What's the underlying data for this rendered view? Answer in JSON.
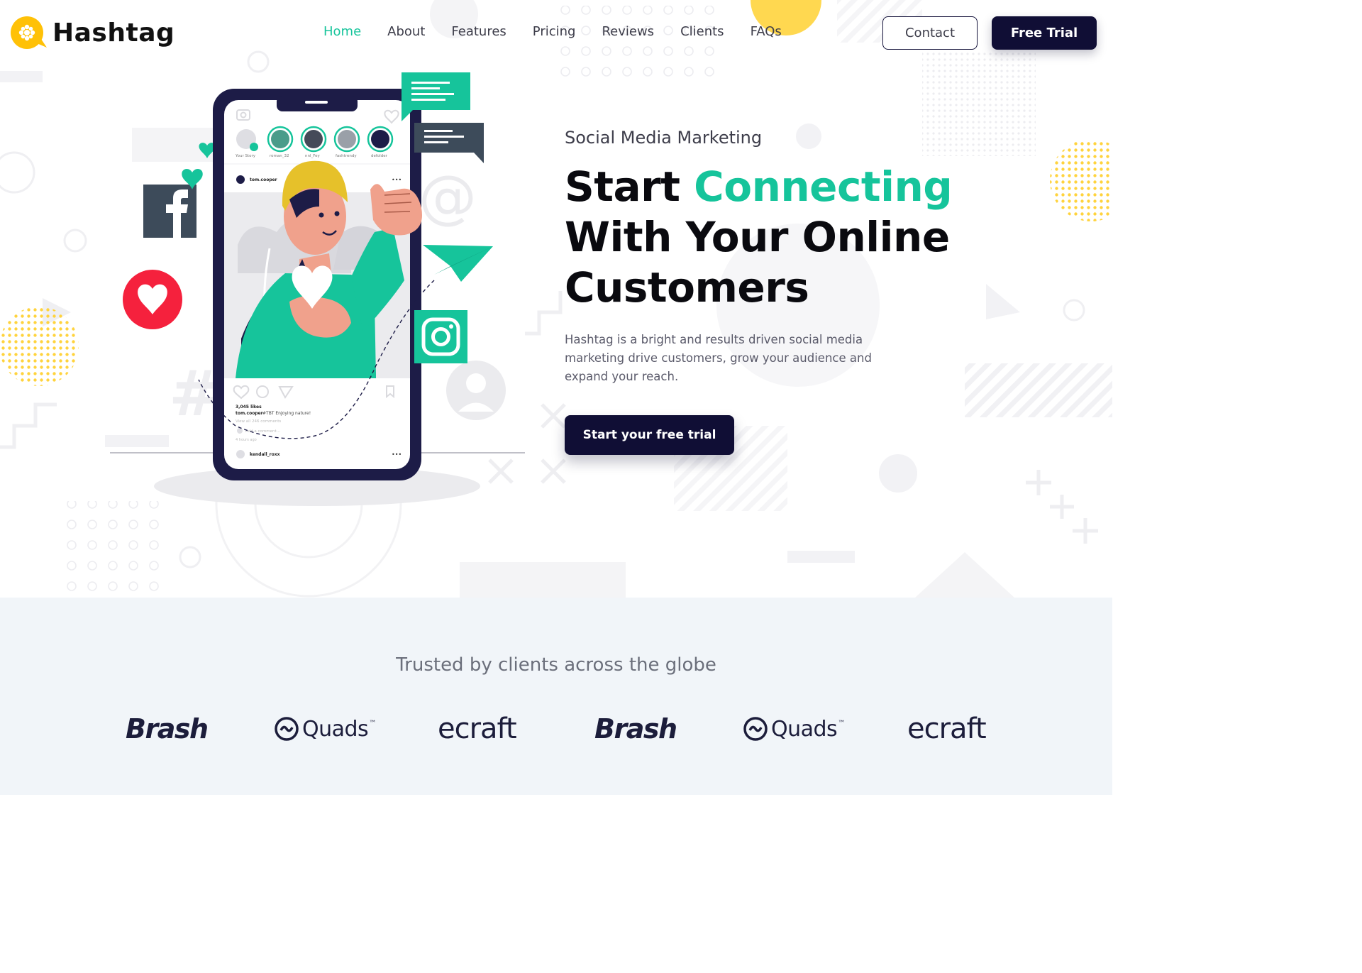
{
  "brand": {
    "name": "Hashtag"
  },
  "nav": {
    "items": [
      {
        "label": "Home"
      },
      {
        "label": "About"
      },
      {
        "label": "Features"
      },
      {
        "label": "Pricing"
      },
      {
        "label": "Reviews"
      },
      {
        "label": "Clients"
      },
      {
        "label": "FAQs"
      }
    ],
    "active": "Home",
    "contact_label": "Contact",
    "trial_label": "Free Trial"
  },
  "hero": {
    "kicker": "Social Media Marketing",
    "headline_part1": "Start ",
    "headline_accent": "Connecting",
    "headline_part2": "With Your Online Customers",
    "description": "Hashtag is a bright and results driven social media marketing drive customers, grow your audience and expand your reach.",
    "cta_label": "Start your free trial"
  },
  "phone_post": {
    "stories": [
      "Your Story",
      "roman_32",
      "nnl_Fey",
      "fashtrendy",
      "defolder"
    ],
    "post_user": "tom.cooper",
    "likes": "3,045 likes",
    "caption_user": "tom.cooper",
    "caption_text": "#TBT  Enjoying nature!",
    "comments_link": "View all 246 comments",
    "add_comment": "Add a comment...",
    "time_ago": "4 hours ago",
    "next_user": "kendall_roxx"
  },
  "clients": {
    "title": "Trusted by clients across the globe",
    "logos": [
      {
        "name": "Brash"
      },
      {
        "name": "Quads",
        "mark": "™"
      },
      {
        "name": "ecraft"
      },
      {
        "name": "Brash"
      },
      {
        "name": "Quads",
        "mark": "™"
      },
      {
        "name": "ecraft"
      }
    ]
  },
  "colors": {
    "accent": "#16c49b",
    "navy": "#100e35",
    "yellow": "#ffd33d",
    "facebook": "#3d4b5a",
    "heart_red": "#f5213d",
    "clients_bg": "#f1f5f9"
  }
}
